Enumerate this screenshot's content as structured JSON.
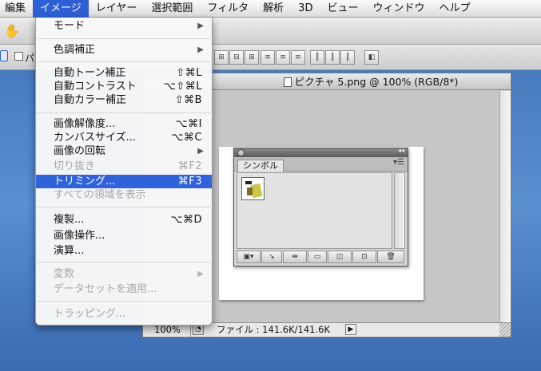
{
  "menubar": {
    "items": [
      "編集",
      "イメージ",
      "レイヤー",
      "選択範囲",
      "フィルタ",
      "解析",
      "3D",
      "ビュー",
      "ウィンドウ",
      "ヘルプ"
    ],
    "active_index": 1
  },
  "options_bar": {
    "tool_label": "パ"
  },
  "image_menu": {
    "items": [
      {
        "label": "モード",
        "shortcut": "",
        "submenu": true,
        "enabled": true
      },
      {
        "label": "色調補正",
        "shortcut": "",
        "submenu": true,
        "enabled": true
      },
      {
        "label": "自動トーン補正",
        "shortcut": "⇧⌘L",
        "submenu": false,
        "enabled": true
      },
      {
        "label": "自動コントラスト",
        "shortcut": "⌥⇧⌘L",
        "submenu": false,
        "enabled": true
      },
      {
        "label": "自動カラー補正",
        "shortcut": "⇧⌘B",
        "submenu": false,
        "enabled": true
      },
      {
        "label": "画像解像度...",
        "shortcut": "⌥⌘I",
        "submenu": false,
        "enabled": true
      },
      {
        "label": "カンバスサイズ...",
        "shortcut": "⌥⌘C",
        "submenu": false,
        "enabled": true
      },
      {
        "label": "画像の回転",
        "shortcut": "",
        "submenu": true,
        "enabled": true
      },
      {
        "label": "切り抜き",
        "shortcut": "⌘F2",
        "submenu": false,
        "enabled": false
      },
      {
        "label": "トリミング...",
        "shortcut": "⌘F3",
        "submenu": false,
        "enabled": true,
        "highlighted": true
      },
      {
        "label": "すべての領域を表示",
        "shortcut": "",
        "submenu": false,
        "enabled": false
      },
      {
        "label": "複製...",
        "shortcut": "⌥⌘D",
        "submenu": false,
        "enabled": true
      },
      {
        "label": "画像操作...",
        "shortcut": "",
        "submenu": false,
        "enabled": true
      },
      {
        "label": "演算...",
        "shortcut": "",
        "submenu": false,
        "enabled": true
      },
      {
        "label": "変数",
        "shortcut": "",
        "submenu": true,
        "enabled": false
      },
      {
        "label": "データセットを適用...",
        "shortcut": "",
        "submenu": false,
        "enabled": false
      },
      {
        "label": "トラッピング...",
        "shortcut": "",
        "submenu": false,
        "enabled": false
      }
    ],
    "highlight_color": "#3062da"
  },
  "document": {
    "title": "ピクチャ 5.png @ 100% (RGB/8*)",
    "zoom": "100%",
    "file_info": "ファイル : 141.6K/141.6K"
  },
  "symbol_panel": {
    "tab_label": "シンボル",
    "symbol_count": 1
  },
  "colors": {
    "accent": "#2f5fd6",
    "desktop": "#4a7fc4"
  }
}
